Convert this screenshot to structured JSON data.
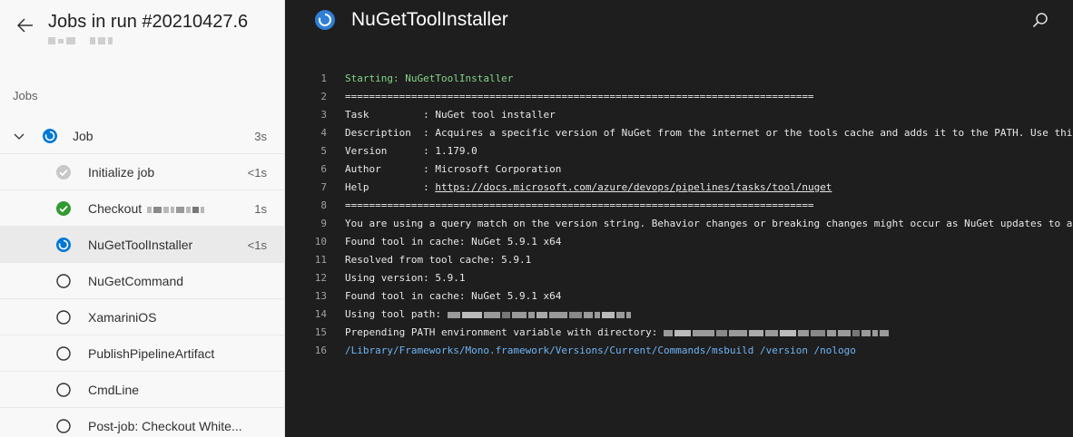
{
  "header": {
    "title": "Jobs in run #20210427.6"
  },
  "jobs_label": "Jobs",
  "job": {
    "name": "Job",
    "duration": "3s"
  },
  "steps": [
    {
      "name": "Initialize job",
      "duration": "<1s",
      "status": "skipped"
    },
    {
      "name": "Checkout",
      "duration": "1s",
      "status": "succeeded"
    },
    {
      "name": "NuGetToolInstaller",
      "duration": "<1s",
      "status": "running"
    },
    {
      "name": "NuGetCommand",
      "duration": "",
      "status": "pending"
    },
    {
      "name": "XamariniOS",
      "duration": "",
      "status": "pending"
    },
    {
      "name": "PublishPipelineArtifact",
      "duration": "",
      "status": "pending"
    },
    {
      "name": "CmdLine",
      "duration": "",
      "status": "pending"
    },
    {
      "name": "Post-job: Checkout White...",
      "duration": "",
      "status": "pending"
    }
  ],
  "log": {
    "title": "NuGetToolInstaller",
    "lines": [
      {
        "n": "1",
        "text": "Starting: NuGetToolInstaller"
      },
      {
        "n": "2",
        "text": "=============================================================================="
      },
      {
        "n": "3",
        "text": "Task         : NuGet tool installer"
      },
      {
        "n": "4",
        "text": "Description  : Acquires a specific version of NuGet from the internet or the tools cache and adds it to the PATH. Use this"
      },
      {
        "n": "5",
        "text": "Version      : 1.179.0"
      },
      {
        "n": "6",
        "text": "Author       : Microsoft Corporation"
      },
      {
        "n": "7",
        "text_prefix": "Help         : ",
        "link": "https://docs.microsoft.com/azure/devops/pipelines/tasks/tool/nuget"
      },
      {
        "n": "8",
        "text": "=============================================================================="
      },
      {
        "n": "9",
        "text": "You are using a query match on the version string. Behavior changes or breaking changes might occur as NuGet updates to a"
      },
      {
        "n": "10",
        "text": "Found tool in cache: NuGet 5.9.1 x64"
      },
      {
        "n": "11",
        "text": "Resolved from tool cache: 5.9.1"
      },
      {
        "n": "12",
        "text": "Using version: 5.9.1"
      },
      {
        "n": "13",
        "text": "Found tool in cache: NuGet 5.9.1 x64"
      },
      {
        "n": "14",
        "text": "Using tool path: "
      },
      {
        "n": "15",
        "text": "Prepending PATH environment variable with directory: "
      },
      {
        "n": "16",
        "text": "/Library/Frameworks/Mono.framework/Versions/Current/Commands/msbuild /version /nologo"
      }
    ]
  },
  "colors": {
    "succeeded": "#339933",
    "running": "#0078d4",
    "skipped": "#c8c8c8",
    "pending": "#323130"
  },
  "icons": {
    "back": "arrow-left-icon",
    "search": "search-icon",
    "chevron": "chevron-down-icon"
  }
}
